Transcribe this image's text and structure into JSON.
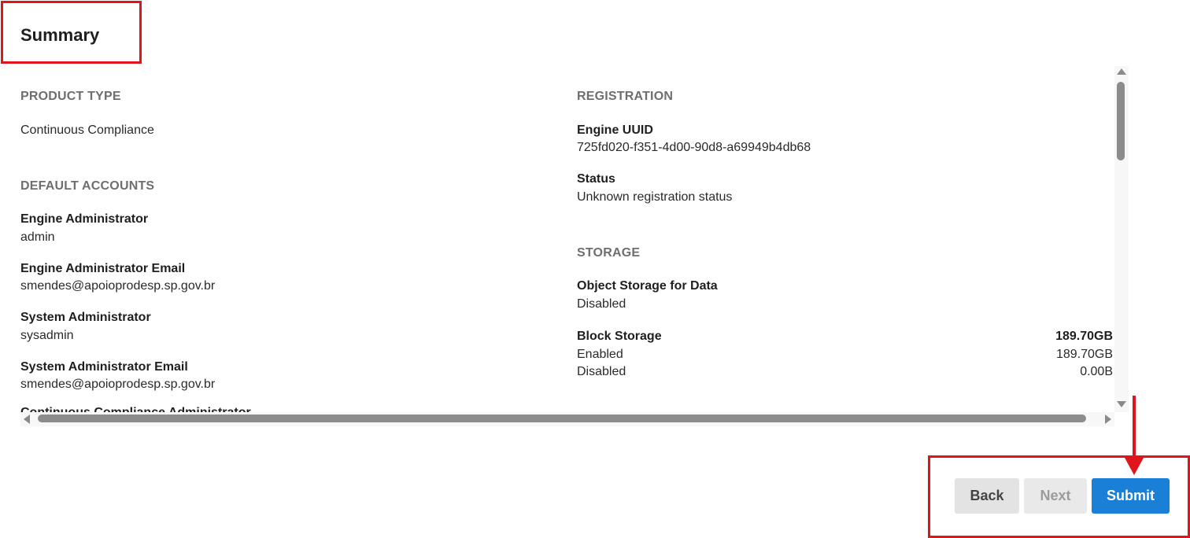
{
  "title": "Summary",
  "left": {
    "product_type": {
      "heading": "PRODUCT TYPE",
      "value": "Continuous Compliance"
    },
    "default_accounts": {
      "heading": "DEFAULT ACCOUNTS",
      "fields": [
        {
          "label": "Engine Administrator",
          "value": "admin"
        },
        {
          "label": "Engine Administrator Email",
          "value": "smendes@apoioprodesp.sp.gov.br"
        },
        {
          "label": "System Administrator",
          "value": "sysadmin"
        },
        {
          "label": "System Administrator Email",
          "value": "smendes@apoioprodesp.sp.gov.br"
        }
      ],
      "partial_label": "Continuous Compliance Administrator"
    }
  },
  "right": {
    "registration": {
      "heading": "REGISTRATION",
      "engine_uuid_label": "Engine UUID",
      "engine_uuid_value": "725fd020-f351-4d00-90d8-a69949b4db68",
      "status_label": "Status",
      "status_value": "Unknown registration status"
    },
    "storage": {
      "heading": "STORAGE",
      "object_storage_label": "Object Storage for Data",
      "object_storage_value": "Disabled",
      "block_storage_label": "Block Storage",
      "block_storage_total": "189.70GB",
      "rows": [
        {
          "label": "Enabled",
          "value": "189.70GB"
        },
        {
          "label": "Disabled",
          "value": "0.00B"
        }
      ]
    }
  },
  "buttons": {
    "back": "Back",
    "next": "Next",
    "submit": "Submit"
  },
  "colors": {
    "annotation": "#e0141b",
    "submit": "#1a7fd6",
    "section_heading": "#6e6e6e"
  }
}
